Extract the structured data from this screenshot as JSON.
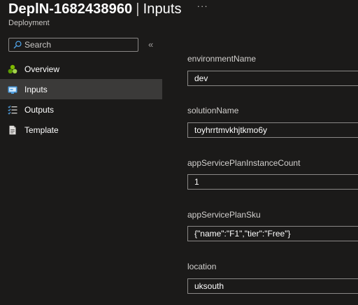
{
  "header": {
    "deployment_name": "DeplN-1682438960",
    "separator": "|",
    "section": "Inputs",
    "subtitle": "Deployment",
    "more_label": "···"
  },
  "search": {
    "placeholder": "Search"
  },
  "collapse_label": "«",
  "nav": {
    "items": [
      {
        "label": "Overview",
        "icon": "overview-icon"
      },
      {
        "label": "Inputs",
        "icon": "inputs-icon",
        "selected": true
      },
      {
        "label": "Outputs",
        "icon": "outputs-icon"
      },
      {
        "label": "Template",
        "icon": "template-icon"
      }
    ]
  },
  "fields": [
    {
      "label": "environmentName",
      "value": "dev"
    },
    {
      "label": "solutionName",
      "value": "toyhrrtmvkhjtkmo6y"
    },
    {
      "label": "appServicePlanInstanceCount",
      "value": "1"
    },
    {
      "label": "appServicePlanSku",
      "value": "{\"name\":\"F1\",\"tier\":\"Free\"}"
    },
    {
      "label": "location",
      "value": "uksouth"
    }
  ],
  "colors": {
    "background": "#1b1a19",
    "selected_nav": "#3b3a39",
    "input_border": "#8a8886",
    "accent_blue": "#4f9fe0",
    "overview_green": "#7fba00"
  }
}
